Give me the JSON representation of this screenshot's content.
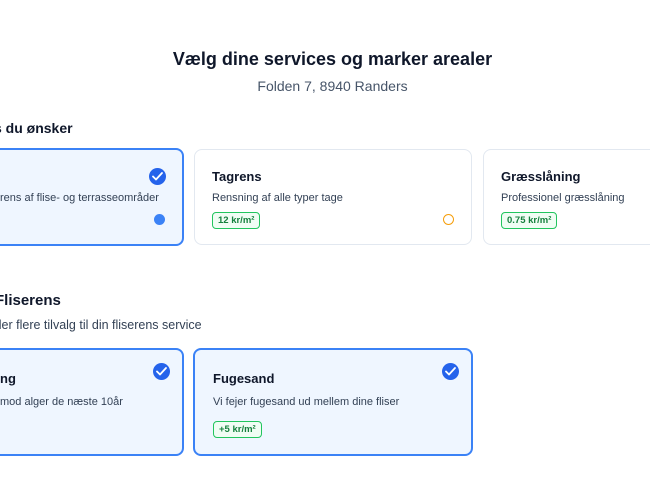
{
  "header": {
    "title": "Vælg dine services og marker arealer",
    "address": "Folden 7, 8940 Randers"
  },
  "services_section": {
    "heading": "s du ønsker",
    "cards": [
      {
        "name": "",
        "description": "rens af flise- og terrasseområder",
        "price": "",
        "selected": true
      },
      {
        "name": "Tagrens",
        "description": "Rensning af alle typer tage",
        "price": "12 kr/m²",
        "selected": false
      },
      {
        "name": "Græsslåning",
        "description": "Professionel græsslåning",
        "price": "0.75 kr/m²",
        "selected": false
      }
    ]
  },
  "addon_section": {
    "heading": "Fliserens",
    "description": "ller flere tilvalg til din fliserens service",
    "cards": [
      {
        "name": "ng",
        "description": "mod alger de næste 10år",
        "price": "",
        "selected": true
      },
      {
        "name": "Fugesand",
        "description": "Vi fejer fugesand ud mellem dine fliser",
        "price": "+5 kr/m²",
        "selected": true
      }
    ]
  },
  "colors": {
    "accent": "#3b82f6",
    "check": "#2563eb",
    "price_green": "#22c55e",
    "pending_orange": "#f59e0b"
  }
}
